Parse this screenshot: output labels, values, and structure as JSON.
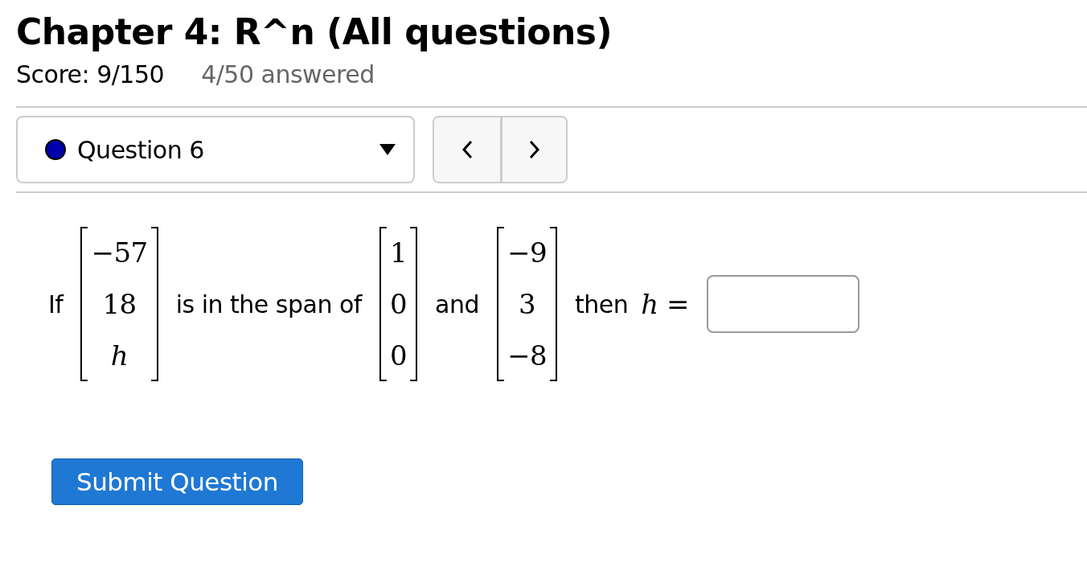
{
  "title": "Chapter 4: R^n (All questions)",
  "score": "Score: 9/150",
  "progress": "4/50 answered",
  "question_select": {
    "label": "Question 6",
    "color": "#0000aa"
  },
  "question": [
    {
      "kind": "text",
      "text": "If"
    },
    {
      "kind": "matrix",
      "entries": [
        {
          "text": "−57",
          "italic": false
        },
        {
          "text": "18",
          "italic": false
        },
        {
          "text": "h",
          "italic": true
        }
      ]
    },
    {
      "kind": "text",
      "text": "is in the span of"
    },
    {
      "kind": "matrix",
      "entries": [
        {
          "text": "1",
          "italic": false
        },
        {
          "text": "0",
          "italic": false
        },
        {
          "text": "0",
          "italic": false
        }
      ]
    },
    {
      "kind": "text",
      "text": "and"
    },
    {
      "kind": "matrix",
      "entries": [
        {
          "text": "−9",
          "italic": false
        },
        {
          "text": "3",
          "italic": false
        },
        {
          "text": "−8",
          "italic": false
        }
      ]
    },
    {
      "kind": "text",
      "text": "then"
    },
    {
      "kind": "math",
      "text": "*h* ="
    },
    {
      "kind": "input"
    }
  ],
  "submit": "Submit Question"
}
